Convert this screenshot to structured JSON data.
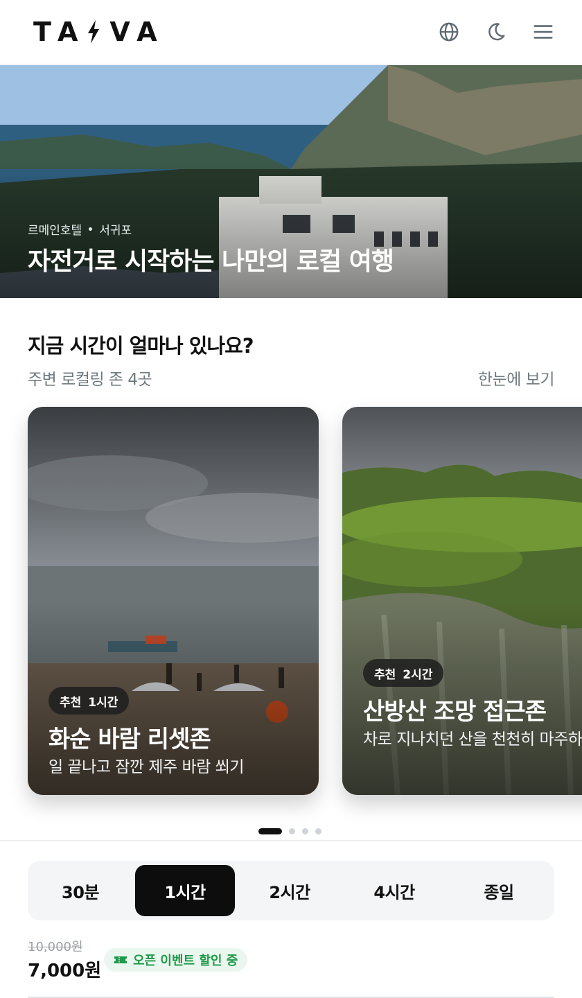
{
  "brand": {
    "logo_left": "TA",
    "logo_right": "VA"
  },
  "header": {
    "icons": [
      "globe-icon",
      "moon-icon",
      "menu-icon"
    ]
  },
  "hero": {
    "hotel": "르메인호텔",
    "area": "서귀포",
    "title": "자전거로 시작하는 나만의 로컬 여행"
  },
  "section": {
    "title": "지금 시간이 얼마나 있나요?",
    "subtitle": "주변 로컬링 존 4곳",
    "view_all": "한눈에 보기"
  },
  "cards": [
    {
      "badge_label": "추천",
      "badge_time": "1시간",
      "title": "화순 바람 리셋존",
      "desc": "일 끝나고 잠깐 제주 바람 쐬기"
    },
    {
      "badge_label": "추천",
      "badge_time": "2시간",
      "title": "산방산 조망 접근존",
      "desc": "차로 지나치던 산을 천천히 마주하기"
    }
  ],
  "pager": {
    "count": 4,
    "active_index": 0
  },
  "time_options": [
    "30분",
    "1시간",
    "2시간",
    "4시간",
    "종일"
  ],
  "time_selected_index": 1,
  "price": {
    "original": "10,000원",
    "current": "7,000원",
    "promo": "오픈 이벤트 할인 중"
  },
  "colors": {
    "accent": "#0d0d0d",
    "promo_green": "#1f9a4a",
    "promo_bg": "#eaf7ee",
    "muted": "#6f7a80"
  }
}
